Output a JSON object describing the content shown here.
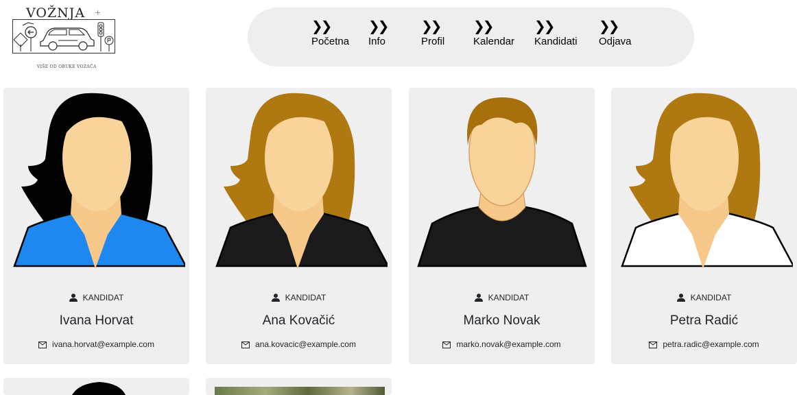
{
  "brand": {
    "title": "VOŽNJA",
    "mark": "+",
    "tagline": "VIŠE OD OBUKE VOZAČA"
  },
  "nav": {
    "items": [
      {
        "label": "Početna",
        "icon": "double-chevron-right-icon"
      },
      {
        "label": "Info",
        "icon": "double-chevron-right-icon"
      },
      {
        "label": "Profil",
        "icon": "double-chevron-right-icon"
      },
      {
        "label": "Kalendar",
        "icon": "double-chevron-right-icon"
      },
      {
        "label": "Kandidati",
        "icon": "double-chevron-right-icon"
      },
      {
        "label": "Odjava",
        "icon": "double-chevron-right-icon"
      }
    ]
  },
  "cards": [
    {
      "role": "KANDIDAT",
      "name": "Ivana Horvat",
      "email": "ivana.horvat@example.com",
      "avatar": "female-avatar-black-hair-blue-top",
      "hair_color": "#000000",
      "top_color": "#1e88f0"
    },
    {
      "role": "KANDIDAT",
      "name": "Ana Kovačić",
      "email": "ana.kovacic@example.com",
      "avatar": "female-avatar-brown-hair-black-top",
      "hair_color": "#b07810",
      "top_color": "#1a1a1a"
    },
    {
      "role": "KANDIDAT",
      "name": "Marko Novak",
      "email": "marko.novak@example.com",
      "avatar": "male-avatar-brown-hair-black-top",
      "hair_color": "#a8700c",
      "top_color": "#1a1a1a"
    },
    {
      "role": "KANDIDAT",
      "name": "Petra Radić",
      "email": "petra.radic@example.com",
      "avatar": "female-avatar-brown-hair-white-top",
      "hair_color": "#b07810",
      "top_color": "#ffffff"
    }
  ],
  "colors": {
    "card_bg": "#efefef",
    "nav_bg": "#eeeeee",
    "skin": "#f6c98b"
  }
}
